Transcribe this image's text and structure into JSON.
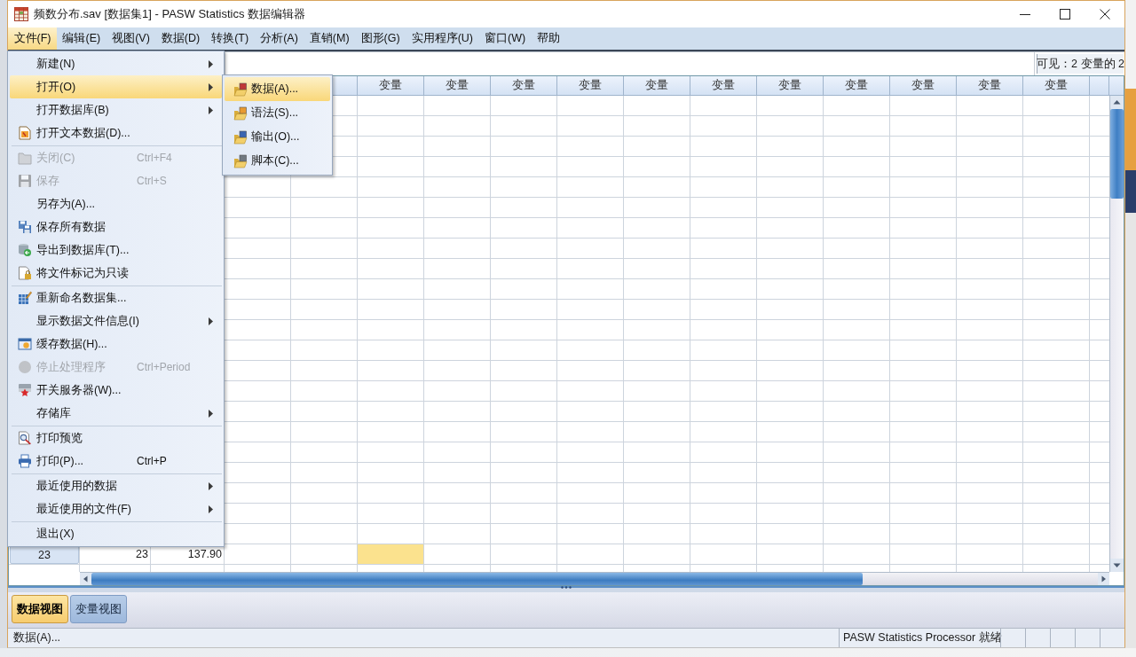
{
  "window": {
    "title": "频数分布.sav [数据集1] - PASW Statistics 数据编辑器"
  },
  "menu_bar": [
    {
      "label": "文件(F)",
      "selected": true
    },
    {
      "label": "编辑(E)",
      "selected": false
    },
    {
      "label": "视图(V)",
      "selected": false
    },
    {
      "label": "数据(D)",
      "selected": false
    },
    {
      "label": "转换(T)",
      "selected": false
    },
    {
      "label": "分析(A)",
      "selected": false
    },
    {
      "label": "直销(M)",
      "selected": false
    },
    {
      "label": "图形(G)",
      "selected": false
    },
    {
      "label": "实用程序(U)",
      "selected": false
    },
    {
      "label": "窗口(W)",
      "selected": false
    },
    {
      "label": "帮助",
      "selected": false
    }
  ],
  "file_menu": [
    {
      "kind": "item",
      "label": "新建(N)",
      "submenu": true,
      "disabled": false,
      "selected": false
    },
    {
      "kind": "item",
      "label": "打开(O)",
      "submenu": true,
      "disabled": false,
      "selected": true
    },
    {
      "kind": "item",
      "label": "打开数据库(B)",
      "submenu": true,
      "disabled": false,
      "selected": false
    },
    {
      "kind": "item",
      "label": "打开文本数据(D)...",
      "submenu": false,
      "disabled": false,
      "selected": false
    },
    {
      "kind": "separator"
    },
    {
      "kind": "item",
      "label": "关闭(C)",
      "shortcut": "Ctrl+F4",
      "submenu": false,
      "disabled": true,
      "selected": false
    },
    {
      "kind": "item",
      "label": "保存",
      "shortcut": "Ctrl+S",
      "submenu": false,
      "disabled": true,
      "selected": false
    },
    {
      "kind": "item",
      "label": "另存为(A)...",
      "submenu": false,
      "disabled": false,
      "selected": false
    },
    {
      "kind": "item",
      "label": "保存所有数据",
      "submenu": false,
      "disabled": false,
      "selected": false
    },
    {
      "kind": "item",
      "label": "导出到数据库(T)...",
      "submenu": false,
      "disabled": false,
      "selected": false
    },
    {
      "kind": "item",
      "label": "将文件标记为只读",
      "submenu": false,
      "disabled": false,
      "selected": false
    },
    {
      "kind": "separator"
    },
    {
      "kind": "item",
      "label": "重新命名数据集...",
      "submenu": false,
      "disabled": false,
      "selected": false
    },
    {
      "kind": "item",
      "label": "显示数据文件信息(I)",
      "submenu": true,
      "disabled": false,
      "selected": false
    },
    {
      "kind": "item",
      "label": "缓存数据(H)...",
      "submenu": false,
      "disabled": false,
      "selected": false
    },
    {
      "kind": "item",
      "label": "停止处理程序",
      "shortcut": "Ctrl+Period",
      "submenu": false,
      "disabled": true,
      "selected": false
    },
    {
      "kind": "item",
      "label": "开关服务器(W)...",
      "submenu": false,
      "disabled": false,
      "selected": false
    },
    {
      "kind": "item",
      "label": "存储库",
      "submenu": true,
      "disabled": false,
      "selected": false
    },
    {
      "kind": "separator"
    },
    {
      "kind": "item",
      "label": "打印预览",
      "submenu": false,
      "disabled": false,
      "selected": false
    },
    {
      "kind": "item",
      "label": "打印(P)...",
      "shortcut": "Ctrl+P",
      "submenu": false,
      "disabled": false,
      "selected": false
    },
    {
      "kind": "separator"
    },
    {
      "kind": "item",
      "label": "最近使用的数据",
      "submenu": true,
      "disabled": false,
      "selected": false
    },
    {
      "kind": "item",
      "label": "最近使用的文件(F)",
      "submenu": true,
      "disabled": false,
      "selected": false
    },
    {
      "kind": "separator"
    },
    {
      "kind": "item",
      "label": "退出(X)",
      "submenu": false,
      "disabled": false,
      "selected": false
    }
  ],
  "open_submenu": [
    {
      "label": "数据(A)...",
      "selected": true
    },
    {
      "label": "语法(S)...",
      "selected": false
    },
    {
      "label": "输出(O)...",
      "selected": false
    },
    {
      "label": "脚本(C)...",
      "selected": false
    }
  ],
  "cell_editor": {
    "visible_variables": "可见：2 变量的 2"
  },
  "table": {
    "columns": [
      "变量",
      "变量",
      "变量",
      "变量",
      "变量",
      "变量",
      "变量",
      "变量",
      "变量",
      "变量",
      "变量"
    ],
    "rows": [
      {
        "number": "23",
        "cells": [
          {
            "text": "23",
            "selected": false
          },
          {
            "text": "137.90",
            "selected": false
          },
          {
            "selected": false
          },
          {
            "selected": false
          },
          {
            "selected": true
          }
        ]
      }
    ]
  },
  "view_tabs": [
    {
      "label": "数据视图",
      "selected": true
    },
    {
      "label": "变量视图",
      "selected": false
    }
  ],
  "status_bar": {
    "message": "数据(A)...",
    "processor": "PASW Statistics Processor 就绪"
  }
}
